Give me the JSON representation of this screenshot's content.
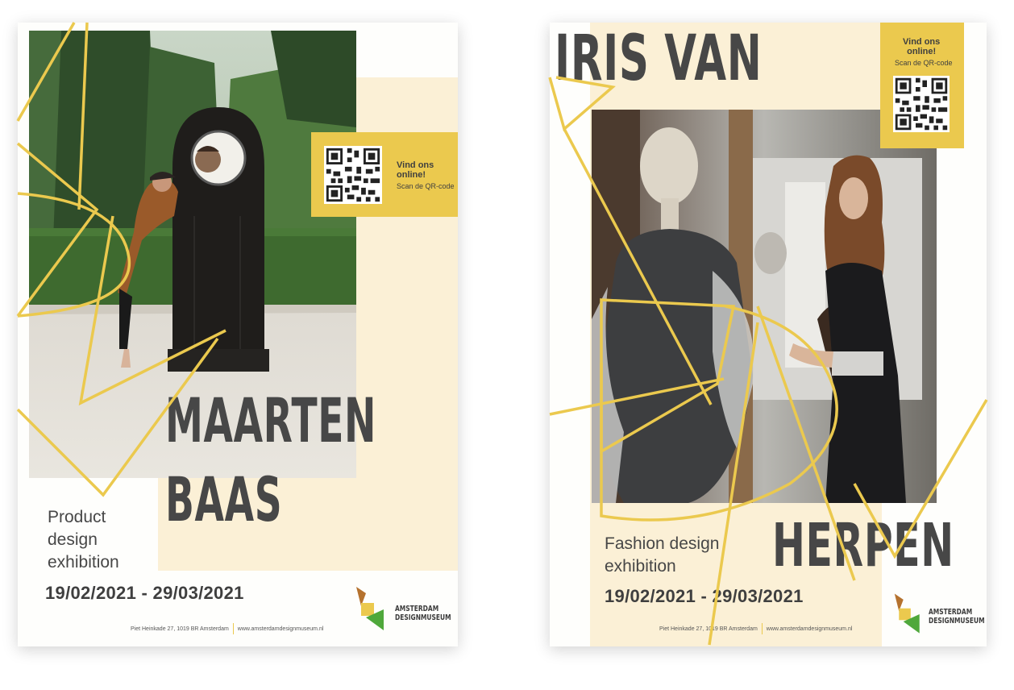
{
  "posters": [
    {
      "name_line1": "MAARTEN",
      "name_line2": "BAAS",
      "description_line1": "Product",
      "description_line2": "design",
      "description_line3": "exhibition",
      "dates": "19/02/2021 - 29/03/2021",
      "address": "Piet Heinkade 27, 1019 BR Amsterdam",
      "website": "www.amsterdamdesignmuseum.nl",
      "qr_title_line1": "Vind ons",
      "qr_title_line2": "online!",
      "qr_subtitle": "Scan de QR-code",
      "logo_line1": "AMSTERDAM",
      "logo_line2": "DESIGNMUSEUM"
    },
    {
      "name_line1": "IRIS VAN",
      "name_line2": "HERPEN",
      "description_line1": "Fashion design",
      "description_line2": "exhibition",
      "dates": "19/02/2021 - 29/03/2021",
      "address": "Piet Heinkade 27, 1019 BR Amsterdam",
      "website": "www.amsterdamdesignmuseum.nl",
      "qr_title_line1": "Vind ons",
      "qr_title_line2": "online!",
      "qr_subtitle": "Scan de QR-code",
      "logo_line1": "AMSTERDAM",
      "logo_line2": "DESIGNMUSEUM"
    }
  ],
  "colors": {
    "accent_yellow": "#ebc94e",
    "beige": "#fbf0d6",
    "text_dark": "#474747",
    "logo_brown": "#b5722e",
    "logo_green": "#4fa83b"
  }
}
